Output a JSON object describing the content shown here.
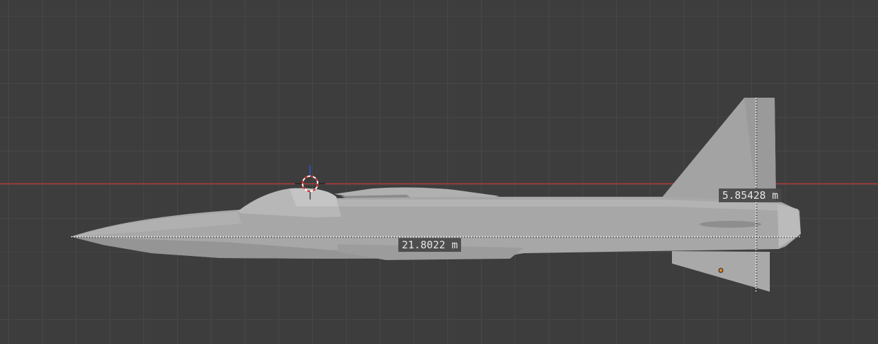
{
  "viewport": {
    "view": "right orthographic",
    "background": "#3d3d3d",
    "grid_color": "#474747",
    "x_axis_color": "#c63a3a"
  },
  "model": {
    "name": "jet aircraft mesh",
    "fill": "#a6a6a6",
    "shade": "#8f8f8f"
  },
  "measurements": {
    "length": {
      "label": "21.8022 m"
    },
    "height": {
      "label": "5.85428 m"
    }
  },
  "cursor": {
    "icon": "3d-cursor-icon"
  },
  "origin": {
    "icon": "object-origin-icon",
    "color": "#e08a1e"
  }
}
